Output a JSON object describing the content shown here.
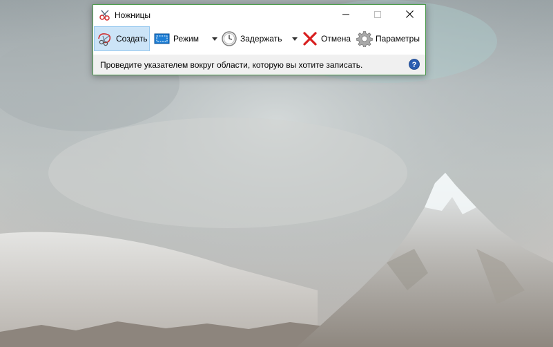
{
  "window": {
    "title": "Ножницы",
    "accent_border": "#4a9a4a"
  },
  "window_controls": {
    "minimize_icon": "minimize-icon",
    "maximize_icon": "maximize-icon",
    "close_icon": "close-icon"
  },
  "toolbar": {
    "new": {
      "label": "Создать",
      "underlined_char": "С",
      "icon": "scissors-icon",
      "active": true
    },
    "mode": {
      "label": "Режим",
      "icon": "rectangle-snip-icon",
      "has_dropdown": true
    },
    "delay": {
      "label": "Задержать",
      "icon": "clock-icon",
      "has_dropdown": true
    },
    "cancel": {
      "label": "Отмена",
      "icon": "red-x-icon"
    },
    "options": {
      "label": "Параметры",
      "icon": "gear-icon"
    }
  },
  "status": {
    "text": "Проведите указателем вокруг области, которую вы хотите записать.",
    "help_icon": "help-icon"
  },
  "colors": {
    "active_button_bg": "#cce4f7",
    "status_bg": "#f0f0f0",
    "help_blue": "#2a5db0",
    "cancel_red": "#d81e1e"
  }
}
